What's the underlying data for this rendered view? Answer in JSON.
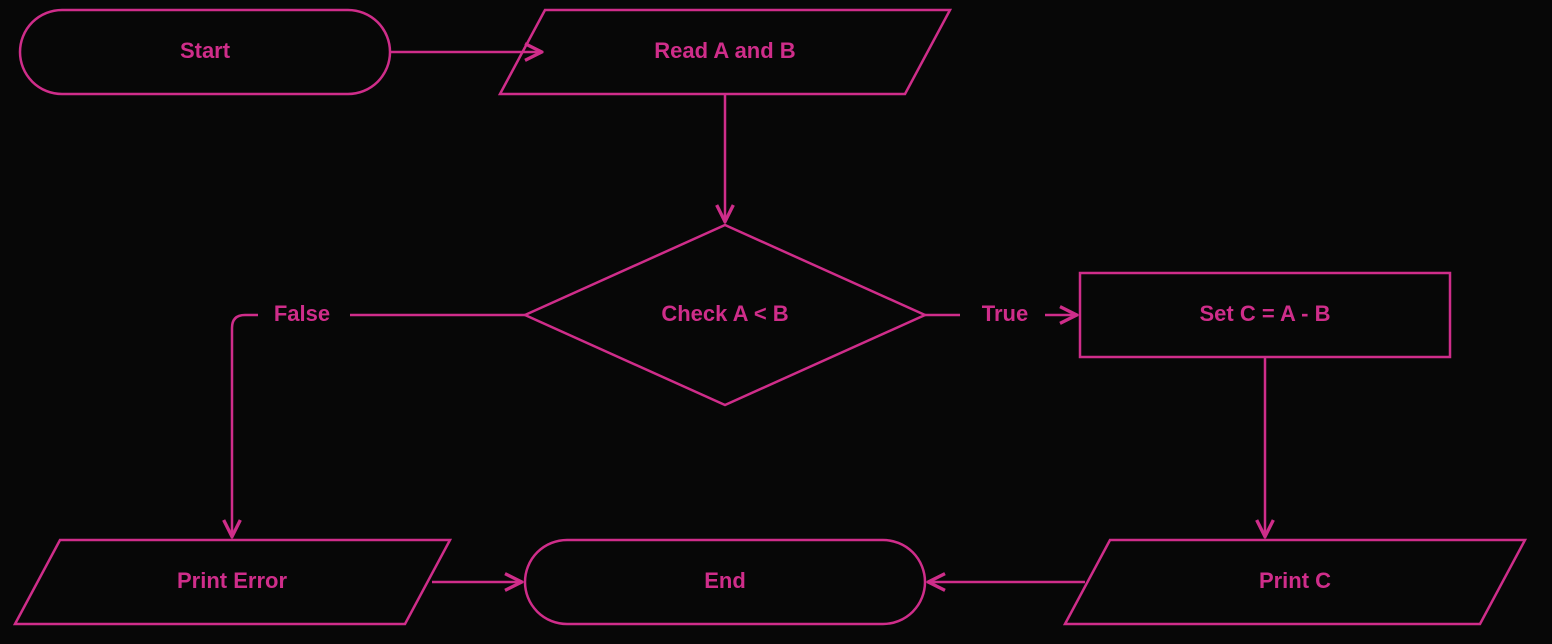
{
  "nodes": {
    "start": {
      "label": "Start"
    },
    "read": {
      "label": "Read A and B"
    },
    "check": {
      "label": "Check A < B"
    },
    "setc": {
      "label": "Set C = A - B"
    },
    "printc": {
      "label": "Print C"
    },
    "printerror": {
      "label": "Print Error"
    },
    "end": {
      "label": "End"
    }
  },
  "edges": {
    "true_label": "True",
    "false_label": "False"
  },
  "color": "#cf2d8a"
}
